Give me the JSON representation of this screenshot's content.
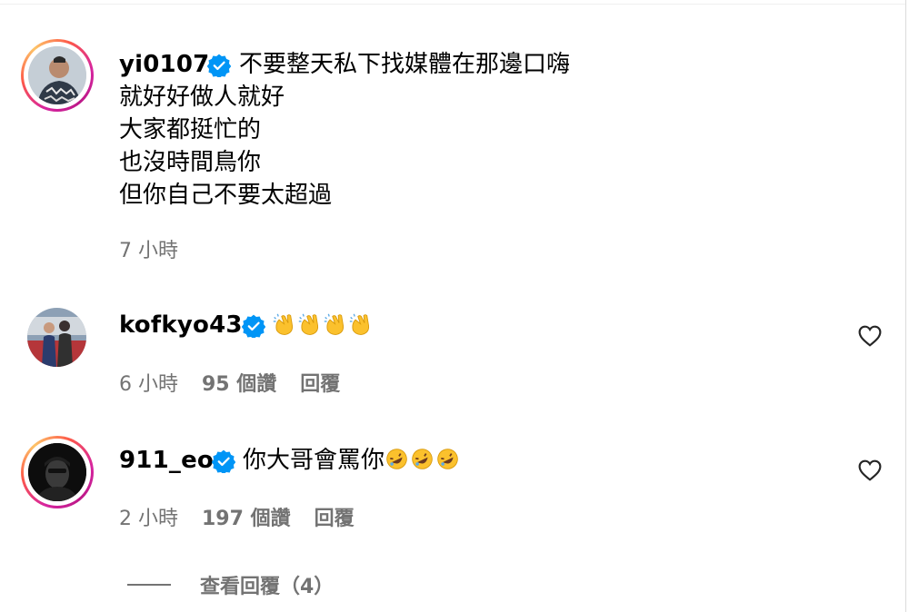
{
  "comments": [
    {
      "username": "yi0107",
      "verified": true,
      "text": "不要整天私下找媒體在那邊口嗨\n就好好做人就好\n大家都挺忙的\n也沒時間鳥你\n但你自己不要太超過",
      "time": "7 小時",
      "has_story_ring": true
    },
    {
      "username": "kofkyo43",
      "verified": true,
      "emoji": [
        "clapping-hands",
        "clapping-hands",
        "clapping-hands",
        "clapping-hands"
      ],
      "time": "6 小時",
      "likes": "95 個讚",
      "reply_label": "回覆",
      "has_story_ring": false
    },
    {
      "username": "911_eo",
      "verified": true,
      "text": "你大哥會罵你",
      "emoji": [
        "rolling-on-floor-laughing",
        "rolling-on-floor-laughing",
        "rolling-on-floor-laughing"
      ],
      "time": "2 小時",
      "likes": "197 個讚",
      "reply_label": "回覆",
      "has_story_ring": true
    }
  ],
  "view_replies_label": "查看回覆（4）",
  "colors": {
    "verified_badge": "#0095f6",
    "meta_text": "#737373"
  }
}
